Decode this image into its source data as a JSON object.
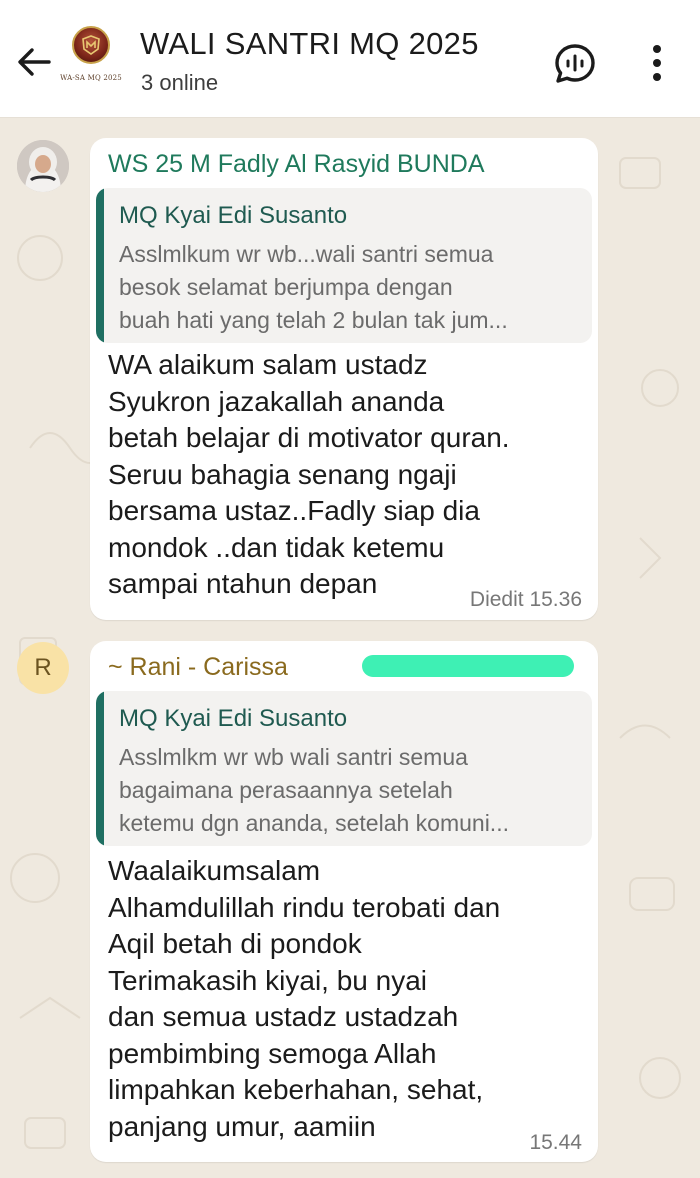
{
  "header": {
    "title": "WALI SANTRI MQ 2025",
    "status": "3 online",
    "logo_caption": "WA-SA MQ 2025",
    "icons": {
      "back": "arrow-left-icon",
      "voice": "voice-chat-icon",
      "menu": "more-vertical-icon"
    }
  },
  "messages": [
    {
      "sender": "WS 25 M Fadly Al Rasyid BUNDA",
      "sender_color": "#1f7a5c",
      "avatar": "profile-photo",
      "quote": {
        "author": "MQ Kyai Edi Susanto",
        "text": "Asslmlkum wr wb...wali santri semua\nbesok selamat berjumpa dengan\nbuah hati yang telah 2 bulan tak jum..."
      },
      "text": "WA alaikum salam ustadz\nSyukron jazakallah ananda\nbetah belajar di motivator quran.\nSeruu bahagia senang ngaji\nbersama ustaz..Fadly siap dia\nmondok ..dan tidak ketemu\nsampai ntahun depan",
      "meta": "Diedit 15.36"
    },
    {
      "sender": "~ Rani - Carissa",
      "sender_color": "#8a6a1e",
      "avatar_letter": "R",
      "quote": {
        "author": "MQ Kyai Edi Susanto",
        "text": "Asslmlkm wr wb wali santri semua\nbagaimana perasaannya setelah\nketemu dgn ananda, setelah komuni..."
      },
      "text": "Waalaikumsalam\nAlhamdulillah rindu terobati dan\nAqil betah di pondok\nTerimakasih kiyai, bu nyai\ndan semua ustadz ustadzah\npembimbing semoga Allah\nlimpahkan keberhahan, sehat,\npanjang umur, aamiin",
      "meta": "15.44"
    }
  ],
  "colors": {
    "header_bg": "#ffffff",
    "wallpaper": "#efe9df",
    "quote_bar": "#1f6f62",
    "redaction": "#3ef0b4"
  }
}
